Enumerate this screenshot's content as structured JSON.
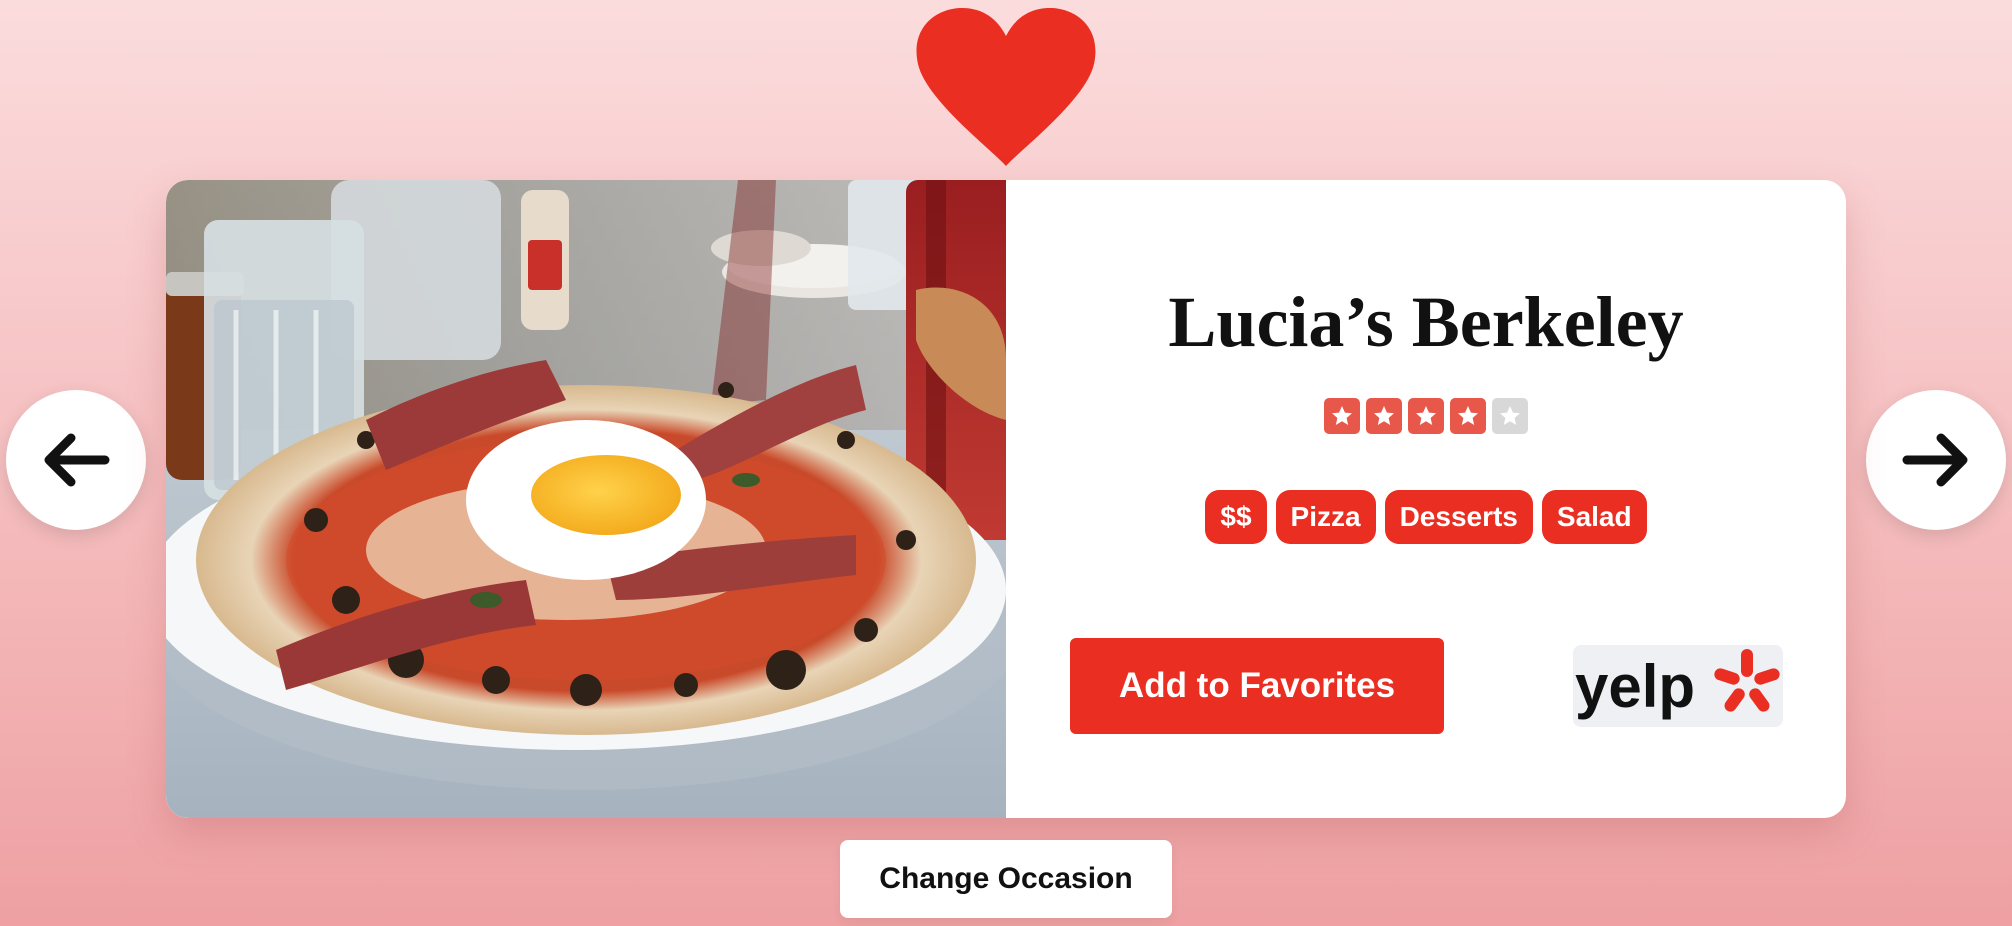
{
  "restaurant": {
    "name": "Lucia’s Berkeley",
    "rating": 4,
    "rating_max": 5,
    "tags": [
      "$$",
      "Pizza",
      "Desserts",
      "Salad"
    ]
  },
  "actions": {
    "add_favorites_label": "Add to Favorites",
    "change_occasion_label": "Change Occasion"
  },
  "yelp": {
    "logo_text": "yelp"
  },
  "icons": {
    "heart": "heart-icon",
    "prev": "arrow-left-icon",
    "next": "arrow-right-icon",
    "star": "star-icon",
    "yelp_burst": "yelp-burst-icon"
  },
  "colors": {
    "accent": "#ea2e22",
    "star_on": "#e8584a",
    "star_off": "#d8d8d8",
    "background_top": "#fbdcdd",
    "background_bottom": "#eea0a2"
  }
}
